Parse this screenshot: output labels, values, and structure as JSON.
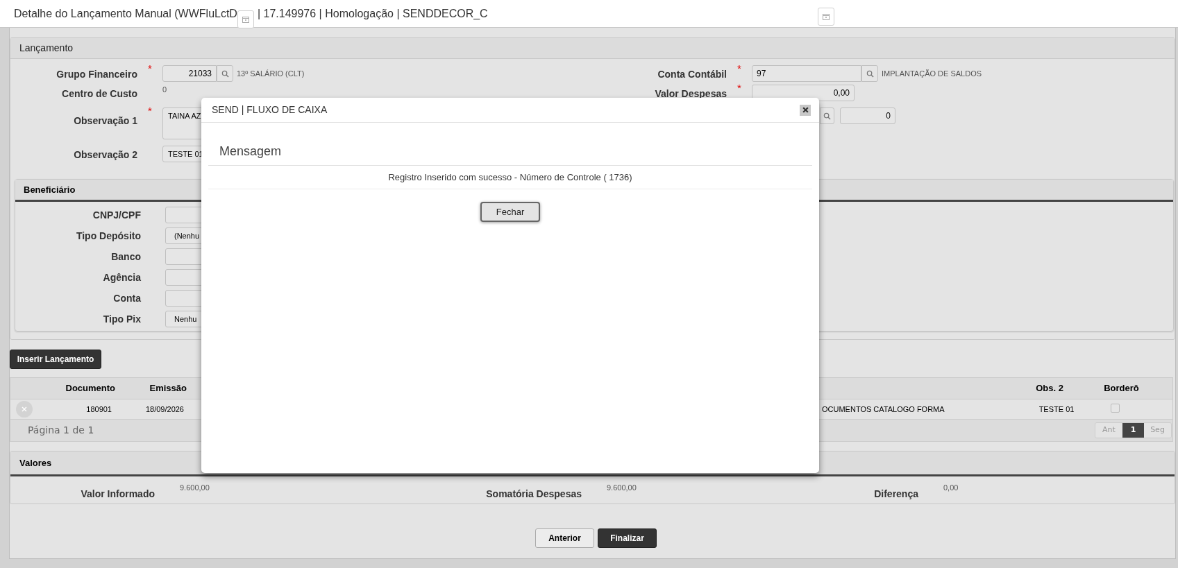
{
  "window": {
    "title_parts": [
      "Detalhe do Lançamento Manual (WWFluLctD",
      "| 17.149976 | Homologação | SENDDECOR_C"
    ]
  },
  "lancamento": {
    "title": "Lançamento",
    "left_fields": [
      {
        "kind": "lookup",
        "label": "Grupo Financeiro",
        "required_mark": "*",
        "value": "21033",
        "description": "13º SALÁRIO (CLT)"
      },
      {
        "kind": "static",
        "label": "Centro de Custo",
        "value": "0"
      },
      {
        "kind": "textarea",
        "label": "Observação 1",
        "required_mark": "*",
        "value": "TAINA AZ"
      },
      {
        "kind": "text",
        "label": "Observação 2",
        "value": "TESTE 01"
      }
    ],
    "right_fields": [
      {
        "kind": "lookup",
        "label": "Conta Contábil",
        "required_mark": "*",
        "value": "97",
        "description": "IMPLANTAÇÃO DE SALDOS"
      },
      {
        "kind": "number",
        "label": "Valor Despesas",
        "required_mark": "*",
        "value": "0,00"
      },
      {
        "kind": "lookup_value",
        "value": "0"
      }
    ]
  },
  "beneficiario": {
    "title": "Beneficiário",
    "fields": [
      {
        "label": "CNPJ/CPF"
      },
      {
        "label": "Tipo Depósito",
        "value": "(Nenhu"
      },
      {
        "label": "Banco"
      },
      {
        "label": "Agência"
      },
      {
        "label": "Conta"
      },
      {
        "label": "Tipo Pix",
        "value": "Nenhu"
      }
    ]
  },
  "insert_button": "Inserir Lançamento",
  "table": {
    "columns": [
      "Documento",
      "Emissão",
      "Obs. 2",
      "Borderô"
    ],
    "rows": [
      {
        "documento": "180901",
        "emissao": "18/09/2026",
        "column_3": "OCUMENTOS CATALOGO FORMA",
        "obs_2": "TESTE 01",
        "bordero_checked": false
      }
    ],
    "page_info": "Página 1 de 1",
    "pager": [
      {
        "label": "Ant",
        "selected": false
      },
      {
        "label": "1",
        "selected": true
      },
      {
        "label": "Seg",
        "selected": false
      }
    ]
  },
  "valores": {
    "title": "Valores",
    "items": [
      {
        "label": "Valor Informado",
        "value": "9.600,00"
      },
      {
        "label": "Somatória Despesas",
        "value": "9.600,00"
      },
      {
        "label": "Diferença",
        "value": "0,00"
      }
    ]
  },
  "footer_buttons": [
    {
      "label": "Anterior",
      "kind": "secondary"
    },
    {
      "label": "Finalizar",
      "kind": "primary"
    }
  ],
  "dialog": {
    "title": "SEND | FLUXO DE CAIXA",
    "heading": "Mensagem",
    "message": "Registro Inserido com sucesso - Número de Controle ( 1736)",
    "button": "Fechar"
  }
}
